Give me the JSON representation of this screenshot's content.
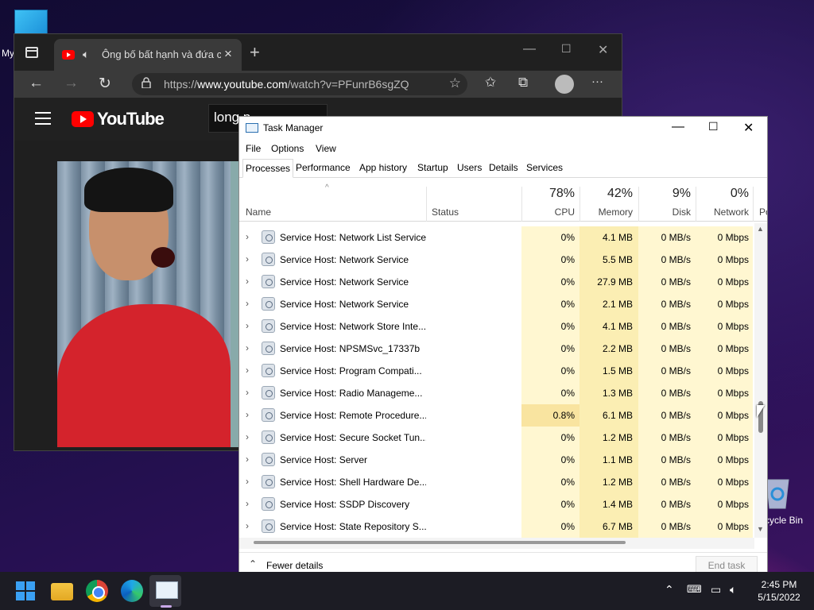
{
  "desktop": {
    "label_my": "My",
    "recycle_label": "cycle Bin"
  },
  "browser": {
    "tab_title": "Ông bố bất hạnh và đứa co",
    "url_prefix": "https://",
    "url_domain": "www.youtube.com",
    "url_path": "/watch?v=PFunrB6sgZQ",
    "youtube_logo": "YouTube",
    "search_value": "long p"
  },
  "taskmgr": {
    "title": "Task Manager",
    "menu": [
      "File",
      "Options",
      "View"
    ],
    "tabs": [
      "Processes",
      "Performance",
      "App history",
      "Startup",
      "Users",
      "Details",
      "Services"
    ],
    "active_tab": "Processes",
    "columns": {
      "name": "Name",
      "status": "Status",
      "cpu_pct": "78%",
      "cpu": "CPU",
      "mem_pct": "42%",
      "mem": "Memory",
      "disk_pct": "9%",
      "disk": "Disk",
      "net_pct": "0%",
      "net": "Network",
      "power": "Po"
    },
    "rows": [
      {
        "name": "Service Host: Network List Service",
        "cpu": "0%",
        "mem": "4.1 MB",
        "disk": "0 MB/s",
        "net": "0 Mbps"
      },
      {
        "name": "Service Host: Network Service",
        "cpu": "0%",
        "mem": "5.5 MB",
        "disk": "0 MB/s",
        "net": "0 Mbps"
      },
      {
        "name": "Service Host: Network Service",
        "cpu": "0%",
        "mem": "27.9 MB",
        "disk": "0 MB/s",
        "net": "0 Mbps"
      },
      {
        "name": "Service Host: Network Service",
        "cpu": "0%",
        "mem": "2.1 MB",
        "disk": "0 MB/s",
        "net": "0 Mbps"
      },
      {
        "name": "Service Host: Network Store Inte...",
        "cpu": "0%",
        "mem": "4.1 MB",
        "disk": "0 MB/s",
        "net": "0 Mbps"
      },
      {
        "name": "Service Host: NPSMSvc_17337b",
        "cpu": "0%",
        "mem": "2.2 MB",
        "disk": "0 MB/s",
        "net": "0 Mbps"
      },
      {
        "name": "Service Host: Program Compati...",
        "cpu": "0%",
        "mem": "1.5 MB",
        "disk": "0 MB/s",
        "net": "0 Mbps"
      },
      {
        "name": "Service Host: Radio Manageme...",
        "cpu": "0%",
        "mem": "1.3 MB",
        "disk": "0 MB/s",
        "net": "0 Mbps"
      },
      {
        "name": "Service Host: Remote Procedure...",
        "cpu": "0.8%",
        "mem": "6.1 MB",
        "disk": "0 MB/s",
        "net": "0 Mbps"
      },
      {
        "name": "Service Host: Secure Socket Tun...",
        "cpu": "0%",
        "mem": "1.2 MB",
        "disk": "0 MB/s",
        "net": "0 Mbps"
      },
      {
        "name": "Service Host: Server",
        "cpu": "0%",
        "mem": "1.1 MB",
        "disk": "0 MB/s",
        "net": "0 Mbps"
      },
      {
        "name": "Service Host: Shell Hardware De...",
        "cpu": "0%",
        "mem": "1.2 MB",
        "disk": "0 MB/s",
        "net": "0 Mbps"
      },
      {
        "name": "Service Host: SSDP Discovery",
        "cpu": "0%",
        "mem": "1.4 MB",
        "disk": "0 MB/s",
        "net": "0 Mbps"
      },
      {
        "name": "Service Host: State Repository S...",
        "cpu": "0%",
        "mem": "6.7 MB",
        "disk": "0 MB/s",
        "net": "0 Mbps"
      }
    ],
    "fewer_details": "Fewer details",
    "end_task": "End task",
    "colors": {
      "cell_light": "#fff7d1",
      "cell_mid": "#fbeeb3",
      "cell_high": "#f9e4a0"
    }
  },
  "taskbar": {
    "time": "2:45 PM",
    "date": "5/15/2022"
  }
}
